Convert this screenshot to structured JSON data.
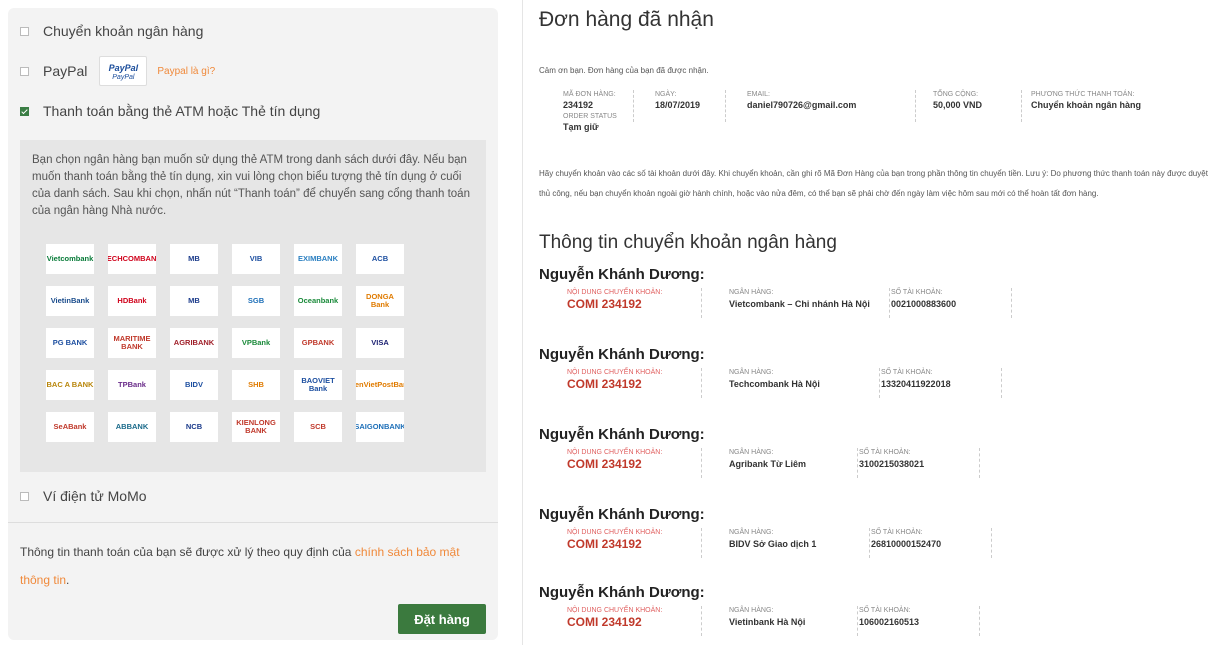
{
  "payment_options": {
    "bank_transfer": "Chuyển khoản ngân hàng",
    "paypal": "PayPal",
    "paypal_logo_top": "PayPal",
    "paypal_logo_bottom": "PayPal",
    "paypal_help": "Paypal là gì?",
    "atm_card": "Thanh toán bằng thẻ ATM hoặc Thẻ tín dụng",
    "momo": "Ví điện tử MoMo"
  },
  "atm_description": "Bạn chọn ngân hàng bạn muốn sử dụng thẻ ATM trong danh sách dưới đây. Nếu bạn muốn thanh toán bằng thẻ tín dụng, xin vui lòng chọn biểu tượng thẻ tín dụng ở cuối của danh sách. Sau khi chọn, nhấn nút “Thanh toán” để chuyển sang cổng thanh toán của ngân hàng Nhà nước.",
  "banks": [
    {
      "name": "Vietcombank",
      "color": "#0a7c3a"
    },
    {
      "name": "TECHCOMBANK",
      "color": "#d0021b"
    },
    {
      "name": "MB",
      "color": "#1a3a8a"
    },
    {
      "name": "VIB",
      "color": "#1d4fa0"
    },
    {
      "name": "EXIMBANK",
      "color": "#2a7fc1"
    },
    {
      "name": "ACB",
      "color": "#1d4fa0"
    },
    {
      "name": "VietinBank",
      "color": "#1a4c8c"
    },
    {
      "name": "HDBank",
      "color": "#d0021b"
    },
    {
      "name": "MB",
      "color": "#1a3a8a"
    },
    {
      "name": "SGB",
      "color": "#1d6fb8"
    },
    {
      "name": "Oceanbank",
      "color": "#1a8a3a"
    },
    {
      "name": "DONGA Bank",
      "color": "#e07b00"
    },
    {
      "name": "PG BANK",
      "color": "#1d4fa0"
    },
    {
      "name": "MARITIME BANK",
      "color": "#c0392b"
    },
    {
      "name": "AGRIBANK",
      "color": "#a0202a"
    },
    {
      "name": "VPBank",
      "color": "#1a8a3a"
    },
    {
      "name": "GPBANK",
      "color": "#c0392b"
    },
    {
      "name": "VISA",
      "color": "#1a1f71"
    },
    {
      "name": "BAC A BANK",
      "color": "#b8860b"
    },
    {
      "name": "TPBank",
      "color": "#6a2c8a"
    },
    {
      "name": "BIDV",
      "color": "#1d4fa0"
    },
    {
      "name": "SHB",
      "color": "#e07b00"
    },
    {
      "name": "BAOVIET Bank",
      "color": "#1d4fa0"
    },
    {
      "name": "LienVietPostBank",
      "color": "#e07b00"
    },
    {
      "name": "SeABank",
      "color": "#c0392b"
    },
    {
      "name": "ABBANK",
      "color": "#1a6a8a"
    },
    {
      "name": "NCB",
      "color": "#1a3a8a"
    },
    {
      "name": "KIENLONG BANK",
      "color": "#c0392b"
    },
    {
      "name": "SCB",
      "color": "#c0392b"
    },
    {
      "name": "SAIGONBANK",
      "color": "#1d6fb8"
    }
  ],
  "privacy_note": "Thông tin thanh toán của bạn sẽ được xử lý theo quy định của ",
  "privacy_link": "chính sách bảo mật thông tin",
  "privacy_end": ".",
  "order_button": "Đặt hàng",
  "order": {
    "title": "Đơn hàng đã nhận",
    "thanks": "Cảm ơn bạn. Đơn hàng của bạn đã được nhận.",
    "summary": [
      {
        "label": "MÃ ĐƠN HÀNG:",
        "value": "234192"
      },
      {
        "label": "NGÀY:",
        "value": "18/07/2019"
      },
      {
        "label": "EMAIL:",
        "value": "daniel790726@gmail.com"
      },
      {
        "label": "TỔNG CỘNG:",
        "value": "50,000 VND"
      },
      {
        "label": "PHƯƠNG THỨC THANH TOÁN:",
        "value": "Chuyển khoản ngân hàng"
      }
    ],
    "status_label": "ORDER STATUS",
    "status_value": "Tạm giữ",
    "instructions": "Hãy chuyển khoản vào các số tài khoản dưới đây. Khi chuyển khoản, cần ghi rõ Mã Đơn Hàng của bạn trong phần thông tin chuyển tiền. Lưu ý: Do phương thức thanh toán này được duyệt thủ công, nếu bạn chuyển khoản ngoài giờ hành chính, hoặc vào nửa đêm, có thể bạn sẽ phải chờ đến ngày làm việc hôm sau mới có thể hoàn tất đơn hàng.",
    "bank_section_title": "Thông tin chuyển khoản ngân hàng",
    "labels": {
      "content": "NỘI DUNG CHUYỂN KHOẢN:",
      "bank": "NGÂN HÀNG:",
      "account": "SỐ TÀI KHOẢN:"
    },
    "accounts": [
      {
        "name": "Nguyễn Khánh Dương:",
        "code": "COMI 234192",
        "bank": "Vietcombank – Chi nhánh Hà Nội",
        "number": "0021000883600"
      },
      {
        "name": "Nguyễn Khánh Dương:",
        "code": "COMI 234192",
        "bank": "Techcombank Hà Nội",
        "number": "13320411922018"
      },
      {
        "name": "Nguyễn Khánh Dương:",
        "code": "COMI 234192",
        "bank": "Agribank Từ Liêm",
        "number": "3100215038021"
      },
      {
        "name": "Nguyễn Khánh Dương:",
        "code": "COMI 234192",
        "bank": "BIDV Sở Giao dịch 1",
        "number": "26810000152470"
      },
      {
        "name": "Nguyễn Khánh Dương:",
        "code": "COMI 234192",
        "bank": "Vietinbank Hà Nội",
        "number": "106002160513"
      }
    ]
  }
}
